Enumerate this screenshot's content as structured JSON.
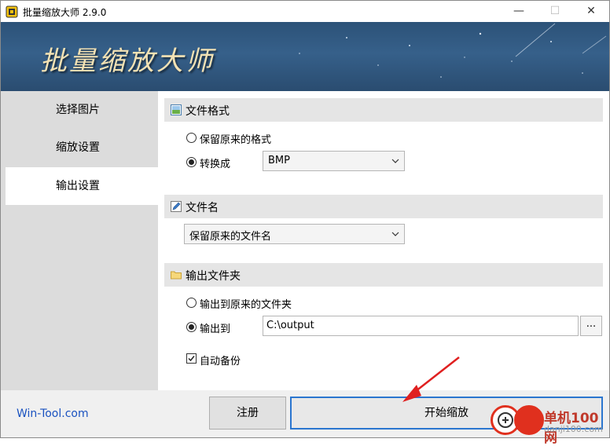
{
  "window": {
    "title": "批量缩放大师 2.9.0",
    "minimize_glyph": "—",
    "maximize_glyph": "☐",
    "close_glyph": "✕"
  },
  "banner": {
    "title": "批量缩放大师"
  },
  "sidebar": {
    "items": [
      {
        "label": "选择图片",
        "active": false
      },
      {
        "label": "缩放设置",
        "active": false
      },
      {
        "label": "输出设置",
        "active": true
      }
    ]
  },
  "file_format": {
    "title": "文件格式",
    "icon": "image-icon",
    "option_keep": "保留原来的格式",
    "option_convert": "转换成",
    "selected_option": "convert",
    "format_value": "BMP"
  },
  "file_name": {
    "title": "文件名",
    "icon": "edit-icon",
    "mode_value": "保留原来的文件名"
  },
  "output_folder": {
    "title": "输出文件夹",
    "icon": "folder-icon",
    "option_original": "输出到原来的文件夹",
    "option_custom": "输出到",
    "selected_option": "custom",
    "path_value": "C:\\output",
    "browse_label": "...",
    "backup_label": "自动备份",
    "backup_checked": true
  },
  "footer": {
    "link": "Win-Tool.com",
    "register_label": "注册",
    "start_label": "开始缩放"
  },
  "watermark": {
    "text": "单机100网",
    "sub": "danji100.com"
  },
  "colors": {
    "accent": "#2b76cf",
    "banner": "#2c5278",
    "link": "#1a52c0",
    "arrow": "#e02020"
  }
}
